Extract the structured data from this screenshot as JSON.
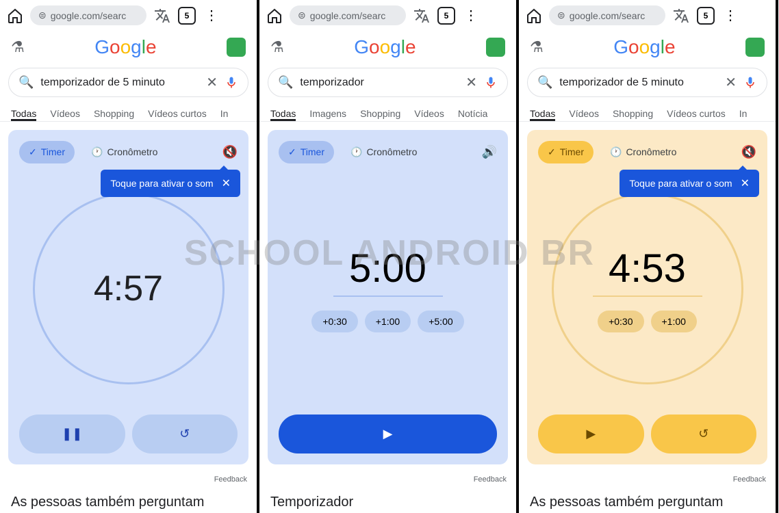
{
  "watermark": "SCHOOL ANDROID BR",
  "browser": {
    "url": "google.com/searc",
    "tab_count": "5"
  },
  "logo_letters": [
    "G",
    "o",
    "o",
    "g",
    "l",
    "e"
  ],
  "common": {
    "timer_chip": "Timer",
    "stopwatch_chip": "Cronômetro",
    "tooltip": "Toque para ativar o som",
    "feedback": "Feedback"
  },
  "panes": [
    {
      "search": "temporizador de 5 minuto",
      "tabs": [
        "Todas",
        "Vídeos",
        "Shopping",
        "Vídeos curtos",
        "In"
      ],
      "time": "4:57",
      "show_tooltip": true,
      "sound_muted": true,
      "style": "running-blue",
      "below": "As pessoas também perguntam"
    },
    {
      "search": "temporizador",
      "tabs": [
        "Todas",
        "Imagens",
        "Shopping",
        "Vídeos",
        "Notícia"
      ],
      "time": "5:00",
      "show_tooltip": false,
      "sound_muted": false,
      "style": "setup-blue",
      "add_buttons": [
        "+0:30",
        "+1:00",
        "+5:00"
      ],
      "below": "Temporizador"
    },
    {
      "search": "temporizador de 5 minuto",
      "tabs": [
        "Todas",
        "Vídeos",
        "Shopping",
        "Vídeos curtos",
        "In"
      ],
      "time": "4:53",
      "show_tooltip": true,
      "sound_muted": true,
      "style": "running-orange",
      "add_buttons": [
        "+0:30",
        "+1:00"
      ],
      "below": "As pessoas também perguntam"
    }
  ]
}
